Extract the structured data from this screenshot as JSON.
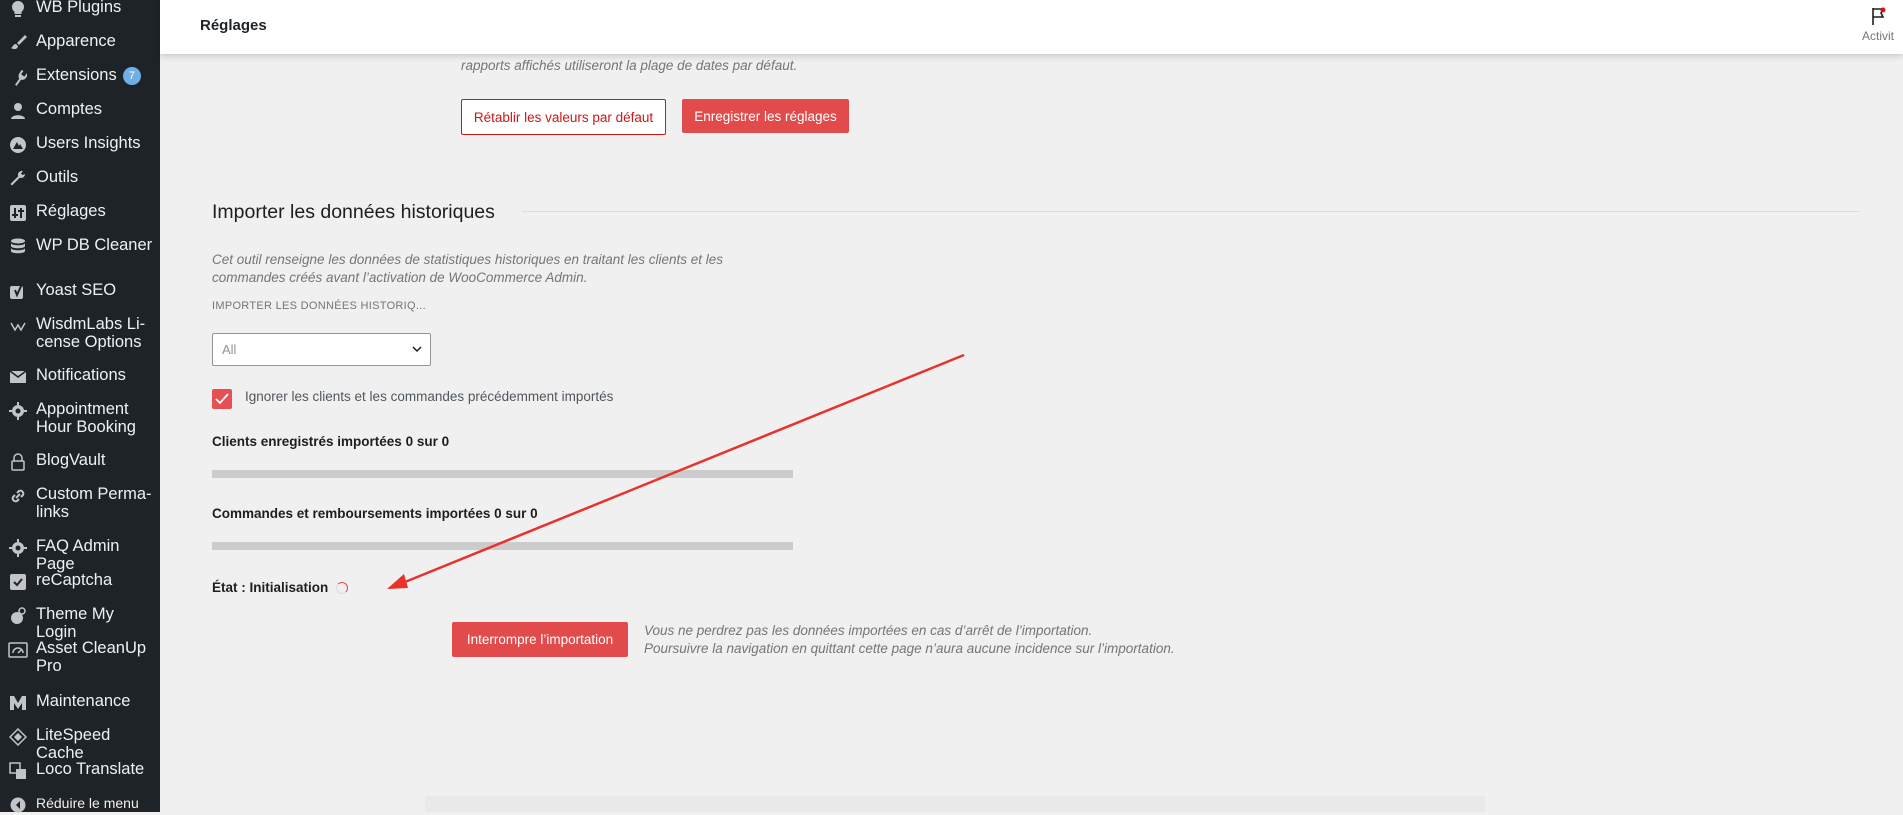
{
  "sidebar": {
    "items": [
      {
        "label": "WB Plugins",
        "icon": "lightbulb-icon"
      },
      {
        "label": "Apparence",
        "icon": "paintbrush-icon"
      },
      {
        "label": "Extensions",
        "icon": "plugin-icon",
        "badge": "7"
      },
      {
        "label": "Comptes",
        "icon": "user-icon"
      },
      {
        "label": "Users Insights",
        "icon": "insights-icon"
      },
      {
        "label": "Outils",
        "icon": "wrench-icon"
      },
      {
        "label": "Réglages",
        "icon": "settings-icon"
      },
      {
        "label": "WP DB Cleaner",
        "icon": "database-icon"
      },
      {
        "label": "Yoast SEO",
        "icon": "yoast-icon"
      },
      {
        "label": "WisdmLabs Li-cense Options",
        "icon": "wisdm-icon"
      },
      {
        "label": "Notifications",
        "icon": "envelope-icon"
      },
      {
        "label": "Appointment Hour Booking",
        "icon": "gear-icon"
      },
      {
        "label": "BlogVault",
        "icon": "lock-icon"
      },
      {
        "label": "Custom Perma-links",
        "icon": "link-icon"
      },
      {
        "label": "FAQ Admin Page",
        "icon": "gear-icon"
      },
      {
        "label": "reCaptcha",
        "icon": "checkmark-icon"
      },
      {
        "label": "Theme My Login",
        "icon": "theme-login-icon"
      },
      {
        "label": "Asset CleanUp Pro",
        "icon": "gauge-icon"
      },
      {
        "label": "Maintenance",
        "icon": "m-icon"
      },
      {
        "label": "LiteSpeed Cache",
        "icon": "diamond-icon"
      },
      {
        "label": "Loco Translate",
        "icon": "translate-icon"
      },
      {
        "label": "Réduire le menu",
        "icon": "collapse-icon"
      }
    ]
  },
  "header": {
    "title": "Réglages",
    "activity_label": "Activit"
  },
  "date_range_note": "rapports affichés utiliseront la plage de dates par défaut.",
  "buttons": {
    "reset": "Rétablir les valeurs par défaut",
    "save": "Enregistrer les réglages"
  },
  "import": {
    "title": "Importer les données historiques",
    "description_line1": "Cet outil renseigne les données de statistiques historiques en traitant les clients et les",
    "description_line2": "commandes créés avant l’activation de WooCommerce Admin.",
    "period_label": "IMPORTER LES DONNÉES HISTORIQ...",
    "period_value": "All",
    "skip_checked": true,
    "skip_label": "Ignorer les clients et les commandes précédemment importés",
    "customers_label": "Clients enregistrés importées 0 sur 0",
    "customers_progress": 0,
    "orders_label": "Commandes et remboursements importées 0 sur 0",
    "orders_progress": 0,
    "status": "État : Initialisation",
    "stop_button": "Interrompre l’importation",
    "note_line1": "Vous ne perdrez pas les données importées en cas d’arrêt de l’importation.",
    "note_line2": "Poursuivre la navigation en quittant cette page n’aura aucune incidence sur l’importation."
  },
  "colors": {
    "sidebar_bg": "#1d2327",
    "accent": "#e14b4b",
    "annotation_arrow": "#e8322c"
  }
}
